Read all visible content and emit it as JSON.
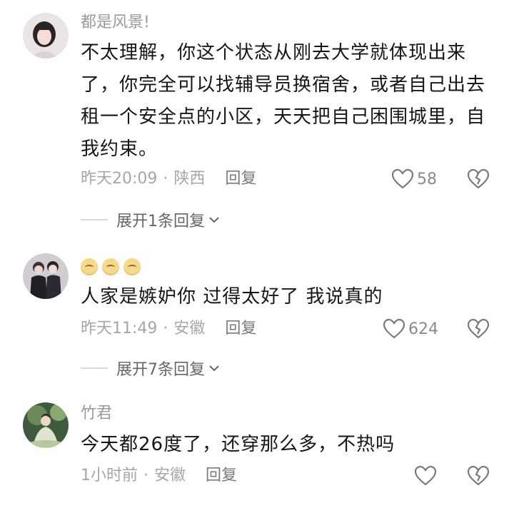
{
  "comments": [
    {
      "username": "都是风景!",
      "text": "不太理解，你这个状态从刚去大学就体现出来了，你完全可以找辅导员换宿舍，或者自己出去租一个安全点的小区，天天把自己困围城里，自我约束。",
      "time": "昨天20:09",
      "location": "陕西",
      "reply_label": "回复",
      "likes": "58",
      "expand_label": "展开1条回复",
      "avatar_icon": "avatar-girl-icon"
    },
    {
      "username": "",
      "username_emoji_count": 3,
      "text": "人家是嫉妒你 过得太好了 我说真的",
      "time": "昨天11:49",
      "location": "安徽",
      "reply_label": "回复",
      "likes": "624",
      "expand_label": "展开7条回复",
      "avatar_icon": "avatar-couple-icon"
    },
    {
      "username": "竹君",
      "text": "今天都26度了，还穿那么多，不热吗",
      "time": "1小时前",
      "location": "安徽",
      "reply_label": "回复",
      "likes": "",
      "avatar_icon": "avatar-figure-icon"
    }
  ],
  "meta_separator": "·",
  "colors": {
    "text": "#161616",
    "meta": "#a6a6a6",
    "background": "#ffffff"
  }
}
